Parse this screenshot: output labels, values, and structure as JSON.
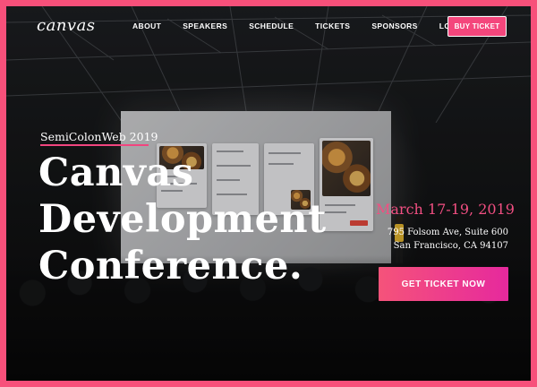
{
  "logo": "canvas",
  "nav": {
    "items": [
      "ABOUT",
      "SPEAKERS",
      "SCHEDULE",
      "TICKETS",
      "SPONSORS",
      "LOCATION"
    ],
    "cta": "BUY TICKET"
  },
  "hero": {
    "eyebrow": "SemiColonWeb 2019",
    "title_lines": [
      "Canvas",
      "Development",
      "Conference."
    ],
    "date": "March 17-19, 2019",
    "address_line1": "795 Folsom Ave, Suite 600",
    "address_line2": "San Francisco, CA 94107",
    "cta": "GET TICKET NOW"
  },
  "colors": {
    "accent": "#f2457f",
    "gradient_start": "#f5537a",
    "gradient_end": "#e6299d"
  }
}
